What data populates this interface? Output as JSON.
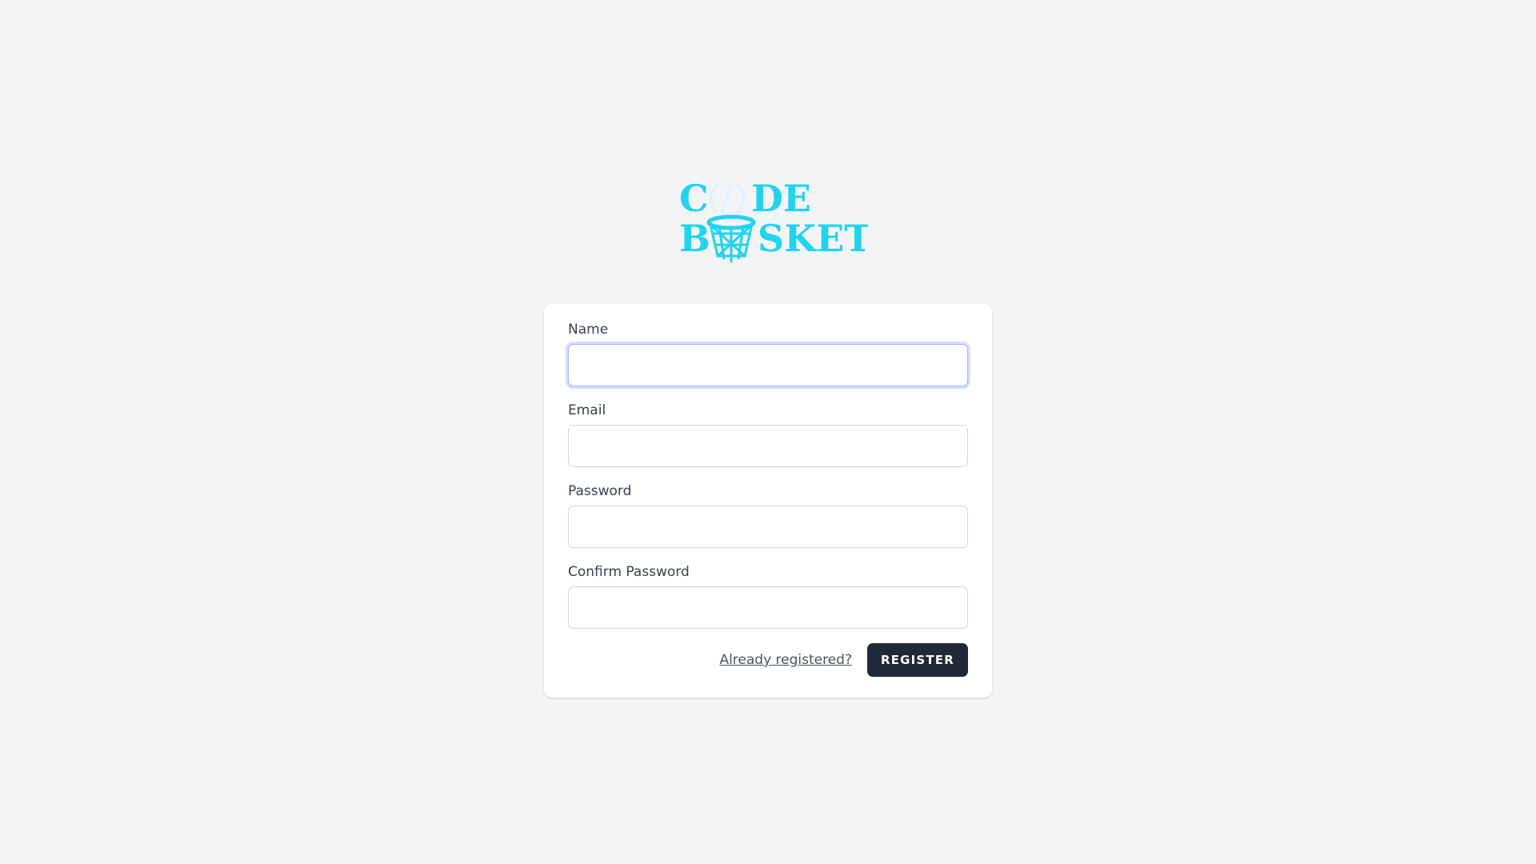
{
  "logo": {
    "line1": "C DE",
    "line2": "B SKET",
    "brand_color": "#22d3ee"
  },
  "form": {
    "name_label": "Name",
    "name_value": "",
    "email_label": "Email",
    "email_value": "",
    "password_label": "Password",
    "password_value": "",
    "confirm_label": "Confirm Password",
    "confirm_value": "",
    "login_link": "Already registered?",
    "submit_label": "REGISTER"
  }
}
